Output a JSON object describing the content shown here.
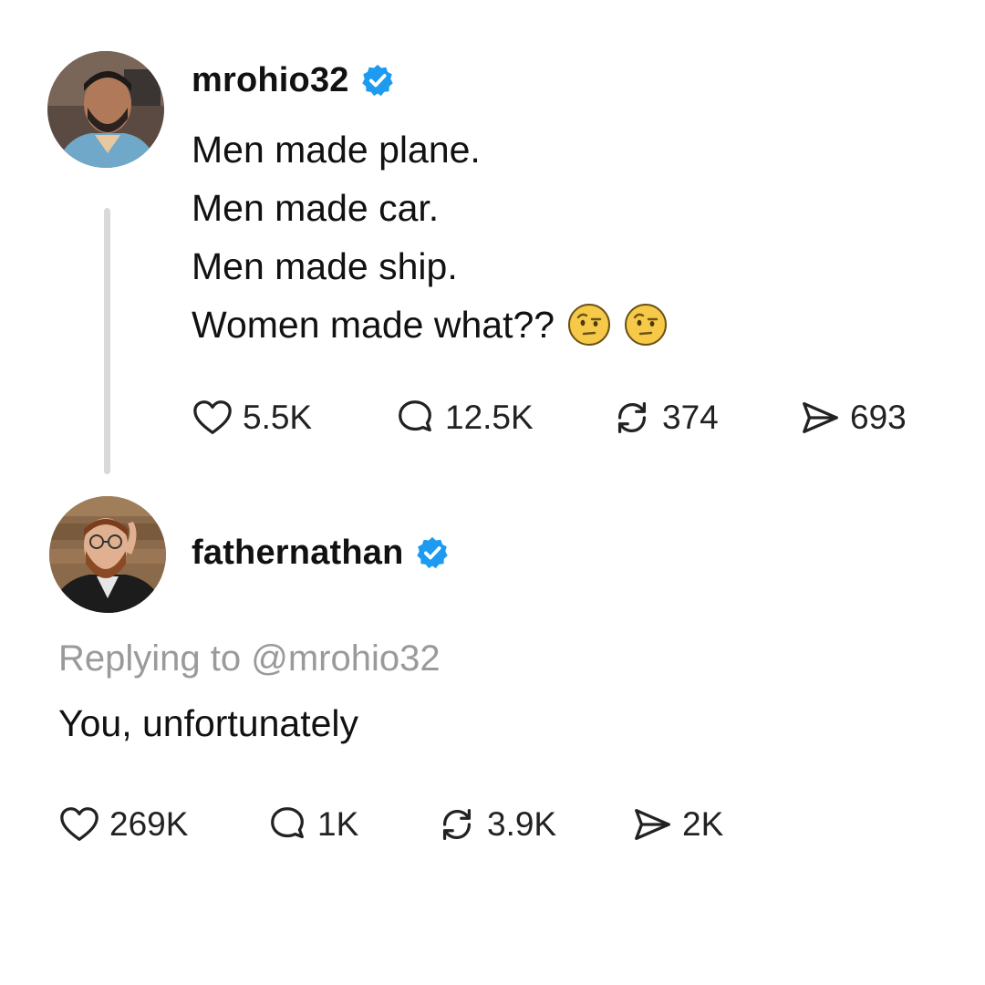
{
  "original_post": {
    "username": "mrohio32",
    "verified": true,
    "lines": [
      "Men made plane.",
      "Men made car.",
      "Men made ship.",
      "Women made what??"
    ],
    "emoji": [
      "face-with-raised-eyebrow-emoji",
      "face-with-raised-eyebrow-emoji"
    ],
    "stats": {
      "likes": "5.5K",
      "comments": "12.5K",
      "reposts": "374",
      "shares": "693"
    }
  },
  "reply_post": {
    "username": "fathernathan",
    "verified": true,
    "replying_to": "Replying to @mrohio32",
    "text": "You, unfortunately",
    "stats": {
      "likes": "269K",
      "comments": "1K",
      "reposts": "3.9K",
      "shares": "2K"
    }
  },
  "icons": {
    "like": "heart-icon",
    "comment": "comment-bubble-icon",
    "repost": "repost-icon",
    "share": "paper-plane-icon",
    "verified": "verified-badge-icon"
  },
  "colors": {
    "verified_blue": "#1d9bf0",
    "text": "#111111",
    "muted_text": "#9a9a9a",
    "thread_line": "#d9d9d9"
  }
}
